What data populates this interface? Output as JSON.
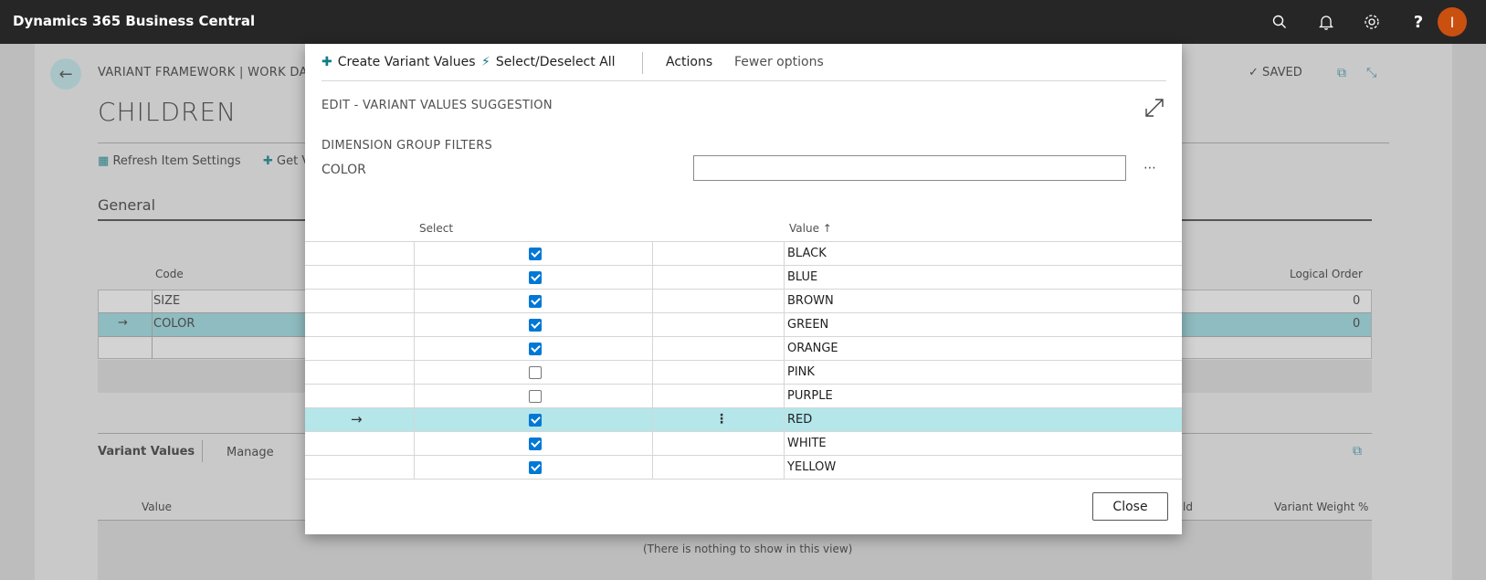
{
  "topbar": {
    "brand": "Dynamics 365 Business Central",
    "icons": [
      "search-icon",
      "bell-icon",
      "gear-icon",
      "help-icon"
    ],
    "avatar_letter": "I"
  },
  "background": {
    "breadcrumb": "VARIANT FRAMEWORK | WORK DATE",
    "page_title": "CHILDREN",
    "saved_label": "SAVED",
    "actions": {
      "refresh": "Refresh Item Settings",
      "get": "Get V"
    },
    "general_tab": "General",
    "grid": {
      "col_code": "Code",
      "col_logical_order": "Logical Order",
      "rows": [
        {
          "code": "SIZE",
          "order": "0"
        },
        {
          "code": "COLOR",
          "order": "0"
        }
      ]
    },
    "variant_values": {
      "title": "Variant Values",
      "manage": "Manage",
      "col_value": "Value",
      "col_ld": "ld",
      "col_weight": "Variant Weight %",
      "empty": "(There is nothing to show in this view)"
    }
  },
  "modal": {
    "toolbar": {
      "create": "Create Variant Values",
      "select_all": "Select/Deselect All",
      "actions": "Actions",
      "fewer": "Fewer options"
    },
    "title": "EDIT - VARIANT VALUES SUGGESTION",
    "section": "DIMENSION GROUP FILTERS",
    "filter_label": "COLOR",
    "filter_value": "",
    "columns": {
      "select": "Select",
      "value": "Value ↑"
    },
    "rows": [
      {
        "value": "BLACK",
        "checked": true
      },
      {
        "value": "BLUE",
        "checked": true
      },
      {
        "value": "BROWN",
        "checked": true
      },
      {
        "value": "GREEN",
        "checked": true
      },
      {
        "value": "ORANGE",
        "checked": true
      },
      {
        "value": "PINK",
        "checked": false
      },
      {
        "value": "PURPLE",
        "checked": false
      },
      {
        "value": "RED",
        "checked": true,
        "selected": true
      },
      {
        "value": "WHITE",
        "checked": true
      },
      {
        "value": "YELLOW",
        "checked": true
      }
    ],
    "close_label": "Close"
  },
  "colors": {
    "accent": "#0e7c86",
    "selected_row": "#b4e6ea",
    "checkbox": "#0078d4",
    "avatar": "#ca5010"
  }
}
